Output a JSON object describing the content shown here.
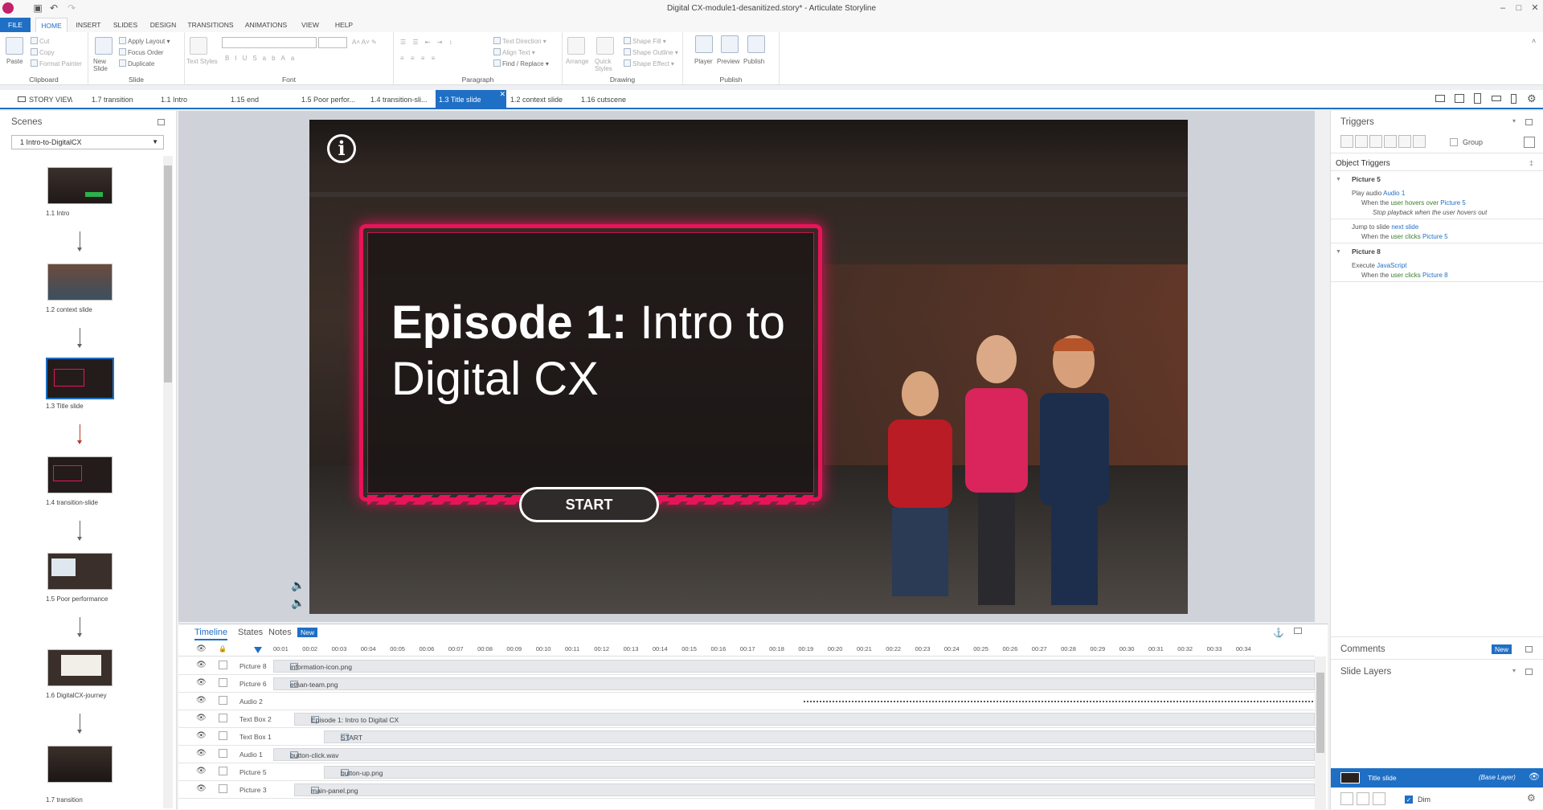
{
  "window": {
    "title": "Digital CX-module1-desanitized.story* - Articulate Storyline"
  },
  "menu": [
    {
      "label": "FILE"
    },
    {
      "label": "HOME"
    },
    {
      "label": "INSERT"
    },
    {
      "label": "SLIDES"
    },
    {
      "label": "DESIGN"
    },
    {
      "label": "TRANSITIONS"
    },
    {
      "label": "ANIMATIONS"
    },
    {
      "label": "VIEW"
    },
    {
      "label": "HELP"
    }
  ],
  "ribbon": {
    "clipboard": {
      "label": "Clipboard",
      "paste": "Paste",
      "cut": "Cut",
      "copy": "Copy",
      "format_painter": "Format Painter"
    },
    "slide": {
      "label": "Slide",
      "new_slide": "New Slide",
      "apply_layout": "Apply Layout",
      "focus_order": "Focus Order",
      "duplicate": "Duplicate"
    },
    "font": {
      "label": "Font",
      "text_styles": "Text Styles"
    },
    "paragraph": {
      "label": "Paragraph",
      "text_direction": "Text Direction",
      "align_text": "Align Text",
      "find_replace": "Find / Replace"
    },
    "drawing": {
      "label": "Drawing",
      "arrange": "Arrange",
      "quick_styles": "Quick Styles",
      "shape_fill": "Shape Fill",
      "shape_outline": "Shape Outline",
      "shape_effect": "Shape Effect"
    },
    "publish": {
      "label": "Publish",
      "player": "Player",
      "preview": "Preview",
      "publish": "Publish"
    }
  },
  "tabs": [
    {
      "label": "STORY VIEW"
    },
    {
      "label": "1.7 transition"
    },
    {
      "label": "1.1 Intro"
    },
    {
      "label": "1.15 end"
    },
    {
      "label": "1.5 Poor perfor..."
    },
    {
      "label": "1.4 transition-sli..."
    },
    {
      "label": "1.3 Title slide"
    },
    {
      "label": "1.2 context slide"
    },
    {
      "label": "1.16 cutscene"
    }
  ],
  "scenes": {
    "title": "Scenes",
    "selected": "1 Intro-to-DigitalCX",
    "items": [
      {
        "label": "1.1 Intro"
      },
      {
        "label": "1.2 context slide"
      },
      {
        "label": "1.3 Title slide"
      },
      {
        "label": "1.4 transition-slide"
      },
      {
        "label": "1.5 Poor performance"
      },
      {
        "label": "1.6 DigitalCX-journey"
      },
      {
        "label": "1.7 transition"
      }
    ]
  },
  "slide": {
    "title_bold": "Episode 1:",
    "title_rest": " Intro to Digital CX",
    "start": "START",
    "info_glyph": "i"
  },
  "timeline": {
    "tabs": {
      "timeline": "Timeline",
      "states": "States",
      "notes": "Notes",
      "new": "New"
    },
    "ticks": [
      "00:01",
      "00:02",
      "00:03",
      "00:04",
      "00:05",
      "00:06",
      "00:07",
      "00:08",
      "00:09",
      "00:10",
      "00:11",
      "00:12",
      "00:13",
      "00:14",
      "00:15",
      "00:16",
      "00:17",
      "00:18",
      "00:19",
      "00:20",
      "00:21",
      "00:22",
      "00:23",
      "00:24",
      "00:25",
      "00:26",
      "00:27",
      "00:28",
      "00:29",
      "00:30",
      "00:31",
      "00:32",
      "00:33",
      "00:34"
    ],
    "rows": [
      {
        "name": "Picture 8",
        "bar": "information-icon.png"
      },
      {
        "name": "Picture 6",
        "bar": "ethan-team.png"
      },
      {
        "name": "Audio 2",
        "bar": ""
      },
      {
        "name": "Text Box 2",
        "bar": "Episode 1: Intro to Digital CX"
      },
      {
        "name": "Text Box 1",
        "bar": "START"
      },
      {
        "name": "Audio 1",
        "bar": "button-click.wav"
      },
      {
        "name": "Picture 5",
        "bar": "button-up.png"
      },
      {
        "name": "Picture 3",
        "bar": "main-panel.png"
      }
    ]
  },
  "triggers": {
    "title": "Triggers",
    "group": "Group",
    "object_triggers": "Object Triggers",
    "groups": [
      {
        "name": "Picture 5",
        "items": [
          {
            "a1": "Play audio ",
            "a2": "Audio 1",
            "b1": "When the ",
            "b2": "user hovers over ",
            "b3": "Picture 5",
            "c": "Stop playback when the user hovers out"
          },
          {
            "a1": "Jump to slide ",
            "a2": "next slide",
            "b1": "When the ",
            "b2": "user clicks ",
            "b3": "Picture 5"
          }
        ]
      },
      {
        "name": "Picture 8",
        "items": [
          {
            "a1": "Execute ",
            "a2": "JavaScript",
            "b1": "When the ",
            "b2": "user clicks ",
            "b3": "Picture 8"
          }
        ]
      }
    ]
  },
  "comments": {
    "title": "Comments",
    "new": "New"
  },
  "layers": {
    "title": "Slide Layers",
    "base_name": "Title slide",
    "base_tag": "(Base Layer)",
    "dim": "Dim"
  },
  "colors": {
    "accent": "#1f6fc5",
    "frame_pink": "#e8145a"
  }
}
